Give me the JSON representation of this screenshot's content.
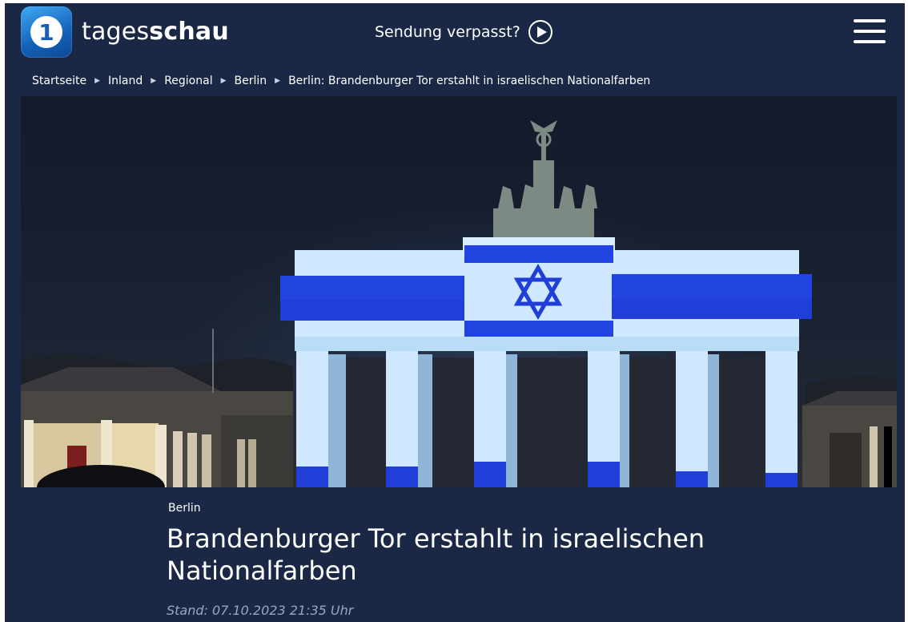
{
  "header": {
    "logo_prefix": "tages",
    "logo_suffix": "schau",
    "logo_symbol": "1",
    "missed_show_label": "Sendung verpasst?",
    "icons": {
      "logo": "ard-one-logo-icon",
      "play": "play-circle-icon",
      "menu": "hamburger-menu-icon"
    }
  },
  "breadcrumb": {
    "items": [
      "Startseite",
      "Inland",
      "Regional",
      "Berlin",
      "Berlin: Brandenburger Tor erstahlt in israelischen Nationalfarben"
    ],
    "separator_icon": "triangle-right-icon"
  },
  "hero_image": {
    "subject": "brandenburg-gate-israeli-flag-projection",
    "colors": {
      "sky": "#141d2f",
      "flag_white": "#cfe8ff",
      "flag_blue": "#1f3fd8"
    }
  },
  "article": {
    "roofline": "Berlin",
    "headline": "Brandenburger Tor erstahlt in israelischen Nationalfarben",
    "stand": "Stand: 07.10.2023 21:35 Uhr"
  },
  "colors": {
    "page_background": "#1a2846",
    "text": "#ffffff",
    "muted_text": "#9aa7bf",
    "logo_blue": "#1461b8"
  }
}
